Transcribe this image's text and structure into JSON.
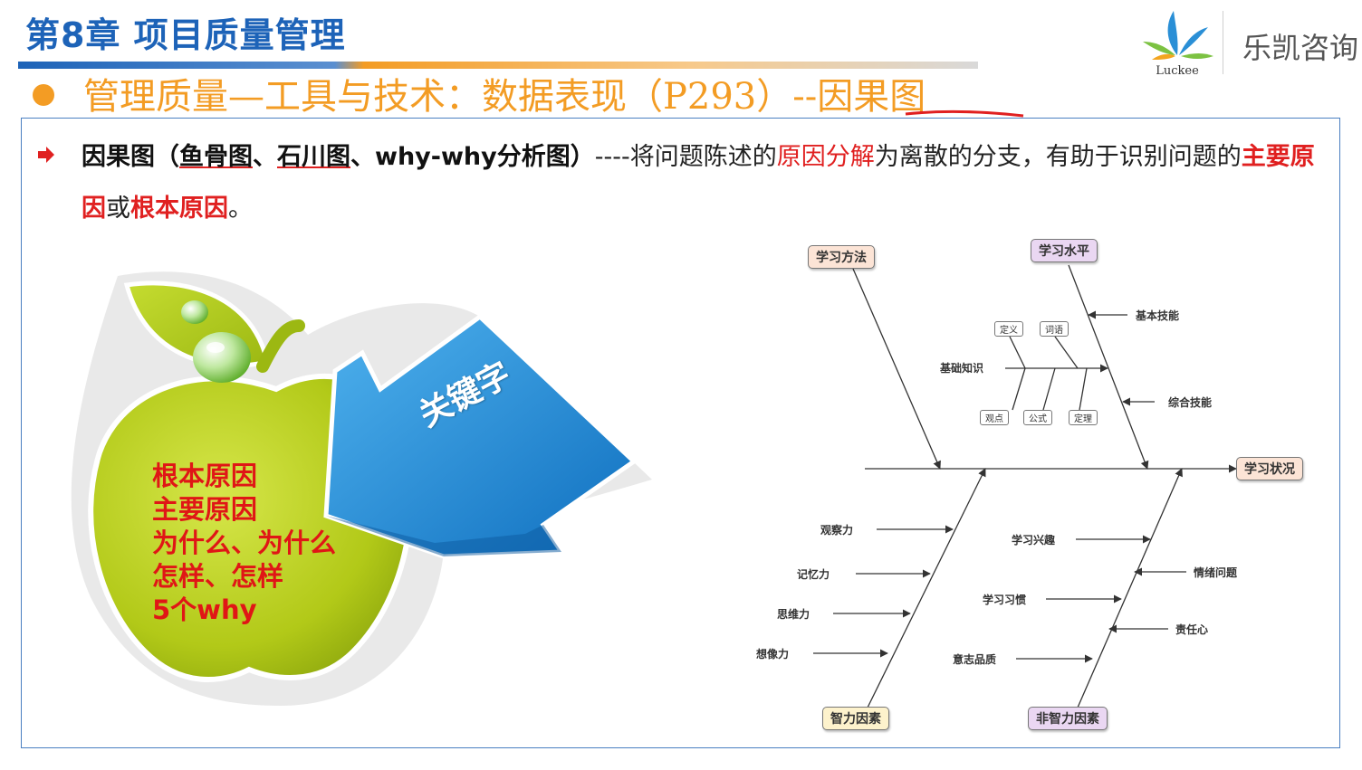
{
  "header": {
    "chapter_title": "第8章 项目质量管理",
    "subtitle": "管理质量—工具与技术：数据表现（P293）--因果图",
    "brand_logo_text": "Luckee",
    "brand_name": "乐凯咨询"
  },
  "content": {
    "term": "因果图（",
    "alias1": "鱼骨图",
    "sep1": "、",
    "alias2": "石川图",
    "sep2": "、why-why分析图）",
    "desc1": "----将问题陈述的",
    "highlight1": "原因分解",
    "desc2": "为离散的分支，有助于识别问题的",
    "highlight2": "主要原因",
    "desc3": "或",
    "highlight3": "根本原因",
    "desc4": "。"
  },
  "keyword_graphic": {
    "arrow_label": "关键字",
    "items": [
      "根本原因",
      "主要原因",
      "为什么、为什么",
      "怎样、怎样",
      "5个why"
    ]
  },
  "fishbone": {
    "effect": "学习状况",
    "top_categories": [
      "学习方法",
      "学习水平"
    ],
    "bottom_categories": [
      "智力因素",
      "非智力因素"
    ],
    "basic_knowledge": "基础知识",
    "knowledge_items_top": [
      "定义",
      "词语"
    ],
    "knowledge_items_bottom": [
      "观点",
      "公式",
      "定理"
    ],
    "level_causes": [
      "基本技能",
      "综合技能"
    ],
    "intelligence_causes": [
      "观察力",
      "记忆力",
      "思维力",
      "想像力"
    ],
    "non_intelligence_left": [
      "学习兴趣",
      "学习习惯",
      "意志品质"
    ],
    "non_intelligence_right": [
      "情绪问题",
      "责任心"
    ]
  },
  "colors": {
    "title_blue": "#1d63b8",
    "accent_orange": "#f39c24",
    "highlight_red": "#e02020",
    "apple_green": "#b5cc18",
    "arrow_blue": "#1f8ad6"
  }
}
